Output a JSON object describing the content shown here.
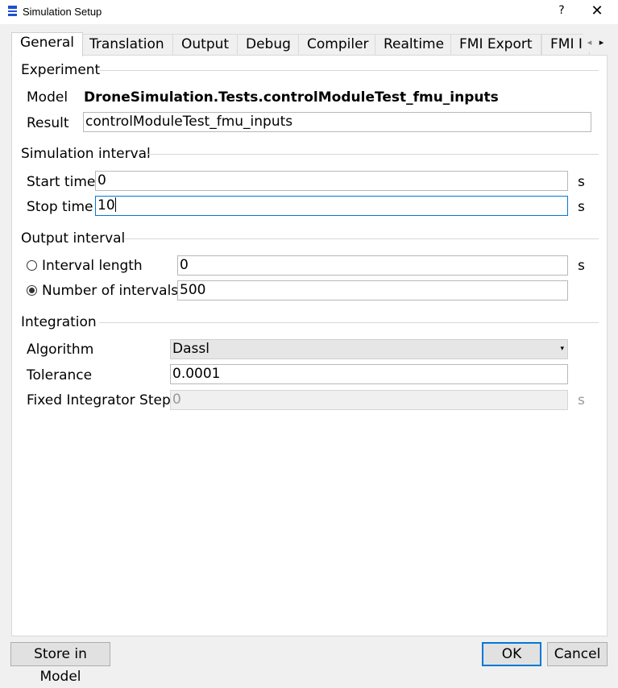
{
  "window": {
    "title": "Simulation Setup",
    "help_label": "?",
    "close_label": "✕"
  },
  "tabs": [
    {
      "label": "General",
      "active": true
    },
    {
      "label": "Translation"
    },
    {
      "label": "Output"
    },
    {
      "label": "Debug"
    },
    {
      "label": "Compiler"
    },
    {
      "label": "Realtime"
    },
    {
      "label": "FMI Export"
    },
    {
      "label": "FMI I"
    }
  ],
  "tab_scroll": {
    "left": "◂",
    "right": "▸"
  },
  "experiment": {
    "header": "Experiment",
    "model_label": "Model",
    "model_value": "DroneSimulation.Tests.controlModuleTest_fmu_inputs",
    "result_label": "Result",
    "result_value": "controlModuleTest_fmu_inputs"
  },
  "simulation_interval": {
    "header": "Simulation interval",
    "start_label": "Start time",
    "start_value": "0",
    "start_unit": "s",
    "stop_label": "Stop time",
    "stop_value": "10",
    "stop_unit": "s"
  },
  "output_interval": {
    "header": "Output interval",
    "interval_length_label": "Interval length",
    "interval_length_value": "0",
    "interval_length_unit": "s",
    "number_label": "Number of intervals",
    "number_value": "500",
    "selected": "Number of intervals"
  },
  "integration": {
    "header": "Integration",
    "algorithm_label": "Algorithm",
    "algorithm_value": "Dassl",
    "tolerance_label": "Tolerance",
    "tolerance_value": "0.0001",
    "fixed_step_label": "Fixed Integrator Step",
    "fixed_step_value": "0",
    "fixed_step_unit": "s"
  },
  "buttons": {
    "store": "Store in Model",
    "ok": "OK",
    "cancel": "Cancel"
  },
  "colors": {
    "focus": "#0078d7",
    "app_icon": "#1f4fd1"
  }
}
